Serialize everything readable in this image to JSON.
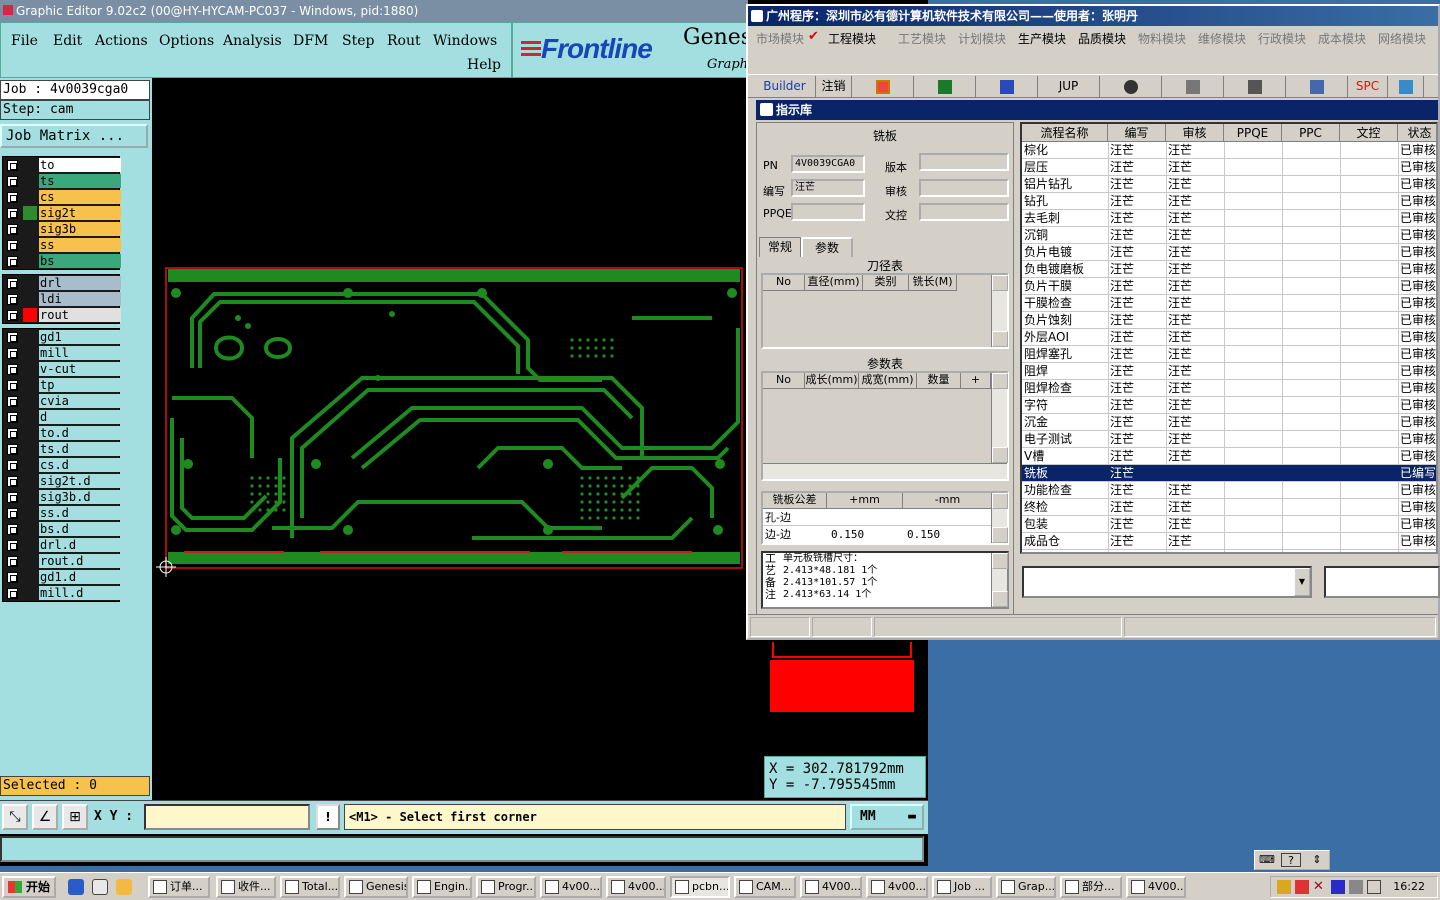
{
  "genesis": {
    "title": "Graphic Editor 9.02c2 (00@HY-HYCAM-PC037 - Windows, pid:1880)",
    "menu": [
      "File",
      "Edit",
      "Actions",
      "Options",
      "Analysis",
      "DFM",
      "Step",
      "Rout",
      "Windows"
    ],
    "help": "Help",
    "logo_text": "Frontline",
    "logo_genesis": "Genes",
    "logo_graph": "Graph",
    "job": "Job : 4v0039cga0",
    "step": "Step: cam",
    "job_matrix": "Job Matrix ...",
    "layers_top": [
      {
        "name": "to",
        "color": "#ffffff",
        "swatch": "#1a1a1a"
      },
      {
        "name": "ts",
        "color": "#3aa87a",
        "swatch": "#1a1a1a"
      },
      {
        "name": "cs",
        "color": "#f7c14e",
        "swatch": "#1a1a1a"
      },
      {
        "name": "sig2t",
        "color": "#f7c14e",
        "swatch": "#2e8b2e"
      },
      {
        "name": "sig3b",
        "color": "#f7c14e",
        "swatch": "#1a1a1a"
      },
      {
        "name": "ss",
        "color": "#f7c14e",
        "swatch": "#1a1a1a"
      },
      {
        "name": "bs",
        "color": "#3aa87a",
        "swatch": "#1a1a1a"
      }
    ],
    "layers_drill": [
      {
        "name": "drl",
        "color": "#a9bccb",
        "swatch": "#1a1a1a"
      },
      {
        "name": "ldi",
        "color": "#a9bccb",
        "swatch": "#1a1a1a"
      },
      {
        "name": "rout",
        "color": "#e0e0e0",
        "swatch": "#ff0000"
      }
    ],
    "layers_misc": [
      {
        "name": "gd1",
        "color": "#a3dfe0"
      },
      {
        "name": "mill",
        "color": "#a3dfe0"
      },
      {
        "name": "v-cut",
        "color": "#a3dfe0"
      },
      {
        "name": "tp",
        "color": "#a3dfe0"
      },
      {
        "name": "cvia",
        "color": "#a3dfe0"
      },
      {
        "name": "d",
        "color": "#a3dfe0"
      },
      {
        "name": "to.d",
        "color": "#a3dfe0"
      },
      {
        "name": "ts.d",
        "color": "#a3dfe0"
      },
      {
        "name": "cs.d",
        "color": "#a3dfe0"
      },
      {
        "name": "sig2t.d",
        "color": "#a3dfe0"
      },
      {
        "name": "sig3b.d",
        "color": "#a3dfe0"
      },
      {
        "name": "ss.d",
        "color": "#a3dfe0"
      },
      {
        "name": "bs.d",
        "color": "#a3dfe0"
      },
      {
        "name": "drl.d",
        "color": "#a3dfe0"
      },
      {
        "name": "rout.d",
        "color": "#a3dfe0"
      },
      {
        "name": "gd1.d",
        "color": "#a3dfe0"
      },
      {
        "name": "mill.d",
        "color": "#a3dfe0"
      }
    ],
    "selected": "Selected : 0",
    "coord_x": "X = 302.781792mm",
    "coord_y": "Y = -7.795545mm",
    "xy_label": "X Y :",
    "prompt": "<M1> - Select first corner",
    "units": "MM",
    "warn": "!"
  },
  "erp": {
    "title": "广州程序：深圳市必有德计算机软件技术有限公司——使用者：张明丹",
    "modules": [
      {
        "label": "市场模块",
        "state": "grey"
      },
      {
        "label": "工程模块",
        "state": "active"
      },
      {
        "label": "工艺模块",
        "state": "grey"
      },
      {
        "label": "计划模块",
        "state": "grey"
      },
      {
        "label": "生产模块",
        "state": "dark"
      },
      {
        "label": "品质模块",
        "state": "dark"
      },
      {
        "label": "物料模块",
        "state": "grey"
      },
      {
        "label": "维修模块",
        "state": "grey"
      },
      {
        "label": "行政模块",
        "state": "grey"
      },
      {
        "label": "成本模块",
        "state": "grey"
      },
      {
        "label": "网络模块",
        "state": "grey"
      }
    ],
    "toolbar": {
      "builder": "Builder",
      "logout": "注销",
      "jup": "JUP",
      "spc": "SPC"
    },
    "sub_title": "指示库",
    "form": {
      "section_title": "铣板",
      "pn_label": "PN",
      "pn_value": "4V0039CGA0",
      "version_label": "版本",
      "writer_label": "编写",
      "writer_value": "汪芒",
      "review_label": "审核",
      "ppqe_label": "PPQE",
      "doc_label": "文控",
      "tab_general": "常规",
      "tab_params": "参数",
      "tool_table_title": "刀径表",
      "tool_headers": [
        "No",
        "直径(mm)",
        "类别",
        "铣长(M)"
      ],
      "param_table_title": "参数表",
      "param_headers": [
        "No",
        "成长(mm)",
        "成宽(mm)",
        "数量",
        "+"
      ],
      "tol_headers": [
        "铣板公差",
        "+mm",
        "-mm"
      ],
      "tol_rows": [
        {
          "name": "孔-边",
          "plus": "",
          "minus": ""
        },
        {
          "name": "边-边",
          "plus": "0.150",
          "minus": "0.150"
        }
      ],
      "memo_side": "工艺备注",
      "memo_lines": [
        "单元板铣槽尺寸：",
        "2.413*48.181  1个",
        "2.413*101.57  1个",
        "2.413*63.14   1个"
      ]
    },
    "flow_headers": [
      "流程名称",
      "编写",
      "审核",
      "PPQE",
      "PPC",
      "文控",
      "状态"
    ],
    "flow_rows": [
      {
        "name": "棕化",
        "writer": "汪芒",
        "reviewer": "汪芒",
        "status": "已审核"
      },
      {
        "name": "层压",
        "writer": "汪芒",
        "reviewer": "汪芒",
        "status": "已审核"
      },
      {
        "name": "铝片钻孔",
        "writer": "汪芒",
        "reviewer": "汪芒",
        "status": "已审核"
      },
      {
        "name": "钻孔",
        "writer": "汪芒",
        "reviewer": "汪芒",
        "status": "已审核"
      },
      {
        "name": "去毛刺",
        "writer": "汪芒",
        "reviewer": "汪芒",
        "status": "已审核"
      },
      {
        "name": "沉铜",
        "writer": "汪芒",
        "reviewer": "汪芒",
        "status": "已审核"
      },
      {
        "name": "负片电镀",
        "writer": "汪芒",
        "reviewer": "汪芒",
        "status": "已审核"
      },
      {
        "name": "负电镀磨板",
        "writer": "汪芒",
        "reviewer": "汪芒",
        "status": "已审核"
      },
      {
        "name": "负片干膜",
        "writer": "汪芒",
        "reviewer": "汪芒",
        "status": "已审核"
      },
      {
        "name": "干膜检查",
        "writer": "汪芒",
        "reviewer": "汪芒",
        "status": "已审核"
      },
      {
        "name": "负片蚀刻",
        "writer": "汪芒",
        "reviewer": "汪芒",
        "status": "已审核"
      },
      {
        "name": "外层AOI",
        "writer": "汪芒",
        "reviewer": "汪芒",
        "status": "已审核"
      },
      {
        "name": "阻焊塞孔",
        "writer": "汪芒",
        "reviewer": "汪芒",
        "status": "已审核"
      },
      {
        "name": "阻焊",
        "writer": "汪芒",
        "reviewer": "汪芒",
        "status": "已审核"
      },
      {
        "name": "阻焊检查",
        "writer": "汪芒",
        "reviewer": "汪芒",
        "status": "已审核"
      },
      {
        "name": "字符",
        "writer": "汪芒",
        "reviewer": "汪芒",
        "status": "已审核"
      },
      {
        "name": "沉金",
        "writer": "汪芒",
        "reviewer": "汪芒",
        "status": "已审核"
      },
      {
        "name": "电子测试",
        "writer": "汪芒",
        "reviewer": "汪芒",
        "status": "已审核"
      },
      {
        "name": "V槽",
        "writer": "汪芒",
        "reviewer": "汪芒",
        "status": "已审核"
      },
      {
        "name": "铣板",
        "writer": "汪芒",
        "reviewer": "",
        "status": "已编写",
        "selected": true
      },
      {
        "name": "功能检查",
        "writer": "汪芒",
        "reviewer": "汪芒",
        "status": "已审核"
      },
      {
        "name": "终检",
        "writer": "汪芒",
        "reviewer": "汪芒",
        "status": "已审核"
      },
      {
        "name": "包装",
        "writer": "汪芒",
        "reviewer": "汪芒",
        "status": "已审核"
      },
      {
        "name": "成品仓",
        "writer": "汪芒",
        "reviewer": "汪芒",
        "status": "已审核"
      }
    ]
  },
  "taskbar": {
    "start": "开始",
    "tasks": [
      "订单...",
      "收件...",
      "Total...",
      "Genesis",
      "Engin...",
      "Progr...",
      "4v00...",
      "4v00...",
      "pcbn...",
      "CAM...",
      "4V00...",
      "4v00...",
      "Job ...",
      "Grap...",
      "部分...",
      "4V00..."
    ],
    "pressed_index": 8,
    "clock": "16:22"
  },
  "colors": {
    "genesis_panel": "#a3dfe0",
    "board_green": "#1f8a1f",
    "board_outline": "#e01010",
    "selection_blue": "#0a246a",
    "desktop": "#3a6ea5"
  }
}
